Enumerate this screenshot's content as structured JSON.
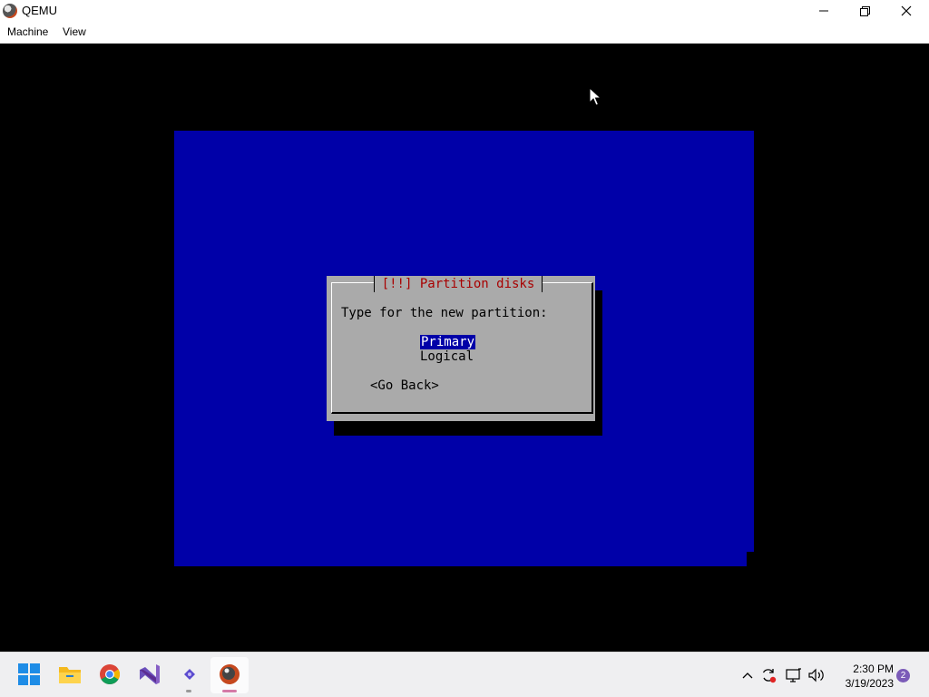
{
  "window": {
    "title": "QEMU",
    "icon": "qemu-icon",
    "controls": [
      "minimize-icon",
      "maximize-icon",
      "close-icon"
    ]
  },
  "menu": {
    "machine": "Machine",
    "view": "View"
  },
  "installer": {
    "background_color": "#0000a8",
    "dialog": {
      "title": "[!!] Partition disks",
      "prompt": "Type for the new partition:",
      "options": [
        {
          "label": "Primary",
          "selected": true
        },
        {
          "label": "Logical",
          "selected": false
        }
      ],
      "go_back": "<Go Back>"
    }
  },
  "taskbar": {
    "apps": [
      "start-icon",
      "file-explorer-icon",
      "chrome-icon",
      "visual-studio-icon",
      "app-icon",
      "qemu-icon"
    ],
    "tray_icons": [
      "chevron-up-icon",
      "sync-icon",
      "network-icon",
      "volume-icon"
    ],
    "time": "2:30 PM",
    "date": "3/19/2023",
    "notification_count": "2"
  }
}
